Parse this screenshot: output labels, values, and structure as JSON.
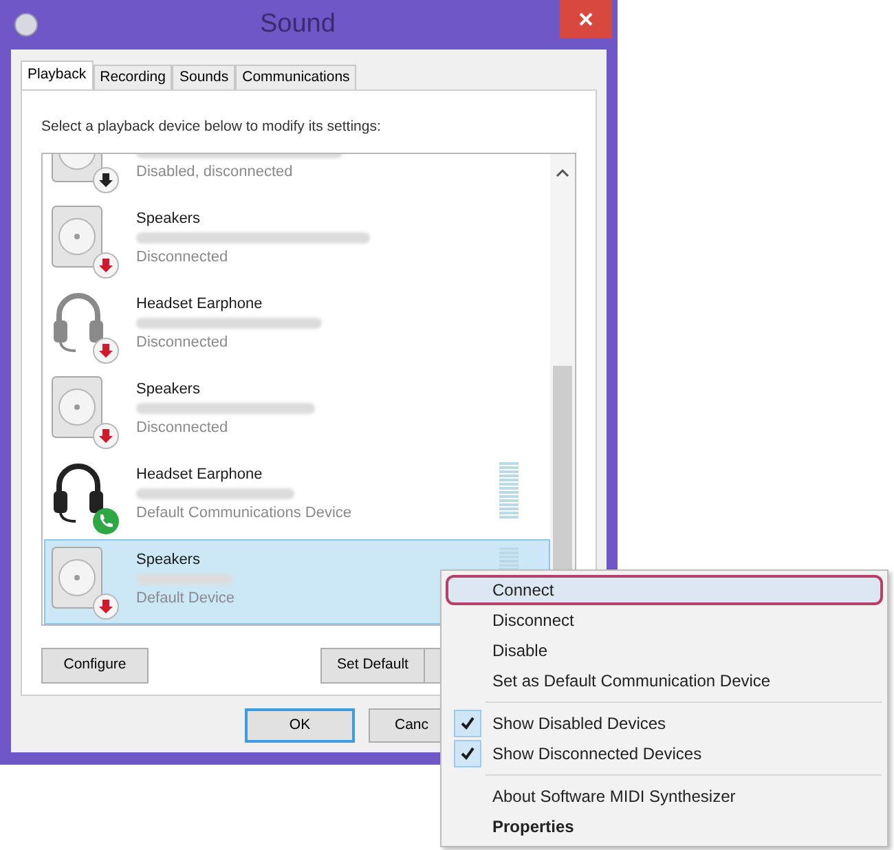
{
  "window": {
    "title": "Sound"
  },
  "tabs": [
    {
      "label": "Playback",
      "selected": true
    },
    {
      "label": "Recording",
      "selected": false
    },
    {
      "label": "Sounds",
      "selected": false
    },
    {
      "label": "Communications",
      "selected": false
    }
  ],
  "instruction": "Select a playback device below to modify its settings:",
  "devices": [
    {
      "kind": "speakers",
      "cut_off": true,
      "status": "Disabled, disconnected",
      "badge": {
        "kind": "disabled"
      },
      "meter": false,
      "selected": false
    },
    {
      "kind": "speakers",
      "cut_off": false,
      "name": "Speakers",
      "status": "Disconnected",
      "badge": {
        "kind": "disconnected"
      },
      "meter": false,
      "selected": false
    },
    {
      "kind": "headset",
      "cut_off": false,
      "name": "Headset Earphone",
      "status": "Disconnected",
      "badge": {
        "kind": "disconnected"
      },
      "meter": false,
      "selected": false
    },
    {
      "kind": "speakers",
      "cut_off": false,
      "name": "Speakers",
      "status": "Disconnected",
      "badge": {
        "kind": "disconnected"
      },
      "meter": false,
      "selected": false
    },
    {
      "kind": "headset",
      "cut_off": false,
      "name": "Headset Earphone",
      "status": "Default Communications Device",
      "badge": {
        "kind": "communications"
      },
      "meter": true,
      "selected": false
    },
    {
      "kind": "speakers",
      "cut_off": false,
      "name": "Speakers",
      "status": "Default Device",
      "badge": {
        "kind": "disconnected"
      },
      "meter": true,
      "selected": true
    }
  ],
  "panel_buttons": [
    {
      "label": "Configure",
      "kind": "plain"
    },
    {
      "label": "Set Default",
      "kind": "split"
    }
  ],
  "dialog_buttons": [
    {
      "label": "OK",
      "default": true
    },
    {
      "label": "Canc",
      "default": false
    }
  ],
  "context_menu": [
    {
      "kind": "item",
      "label": "Connect",
      "highlighted": true,
      "checked": false,
      "bold": false
    },
    {
      "kind": "item",
      "label": "Disconnect",
      "highlighted": false,
      "checked": false,
      "bold": false
    },
    {
      "kind": "item",
      "label": "Disable",
      "highlighted": false,
      "checked": false,
      "bold": false
    },
    {
      "kind": "item",
      "label": "Set as Default Communication Device",
      "highlighted": false,
      "checked": false,
      "bold": false
    },
    {
      "kind": "separator"
    },
    {
      "kind": "item",
      "label": "Show Disabled Devices",
      "highlighted": false,
      "checked": true,
      "bold": false
    },
    {
      "kind": "item",
      "label": "Show Disconnected Devices",
      "highlighted": false,
      "checked": true,
      "bold": false
    },
    {
      "kind": "separator"
    },
    {
      "kind": "item",
      "label": "About Software MIDI Synthesizer",
      "highlighted": false,
      "checked": false,
      "bold": false
    },
    {
      "kind": "item",
      "label": "Properties",
      "highlighted": false,
      "checked": false,
      "bold": true
    }
  ]
}
